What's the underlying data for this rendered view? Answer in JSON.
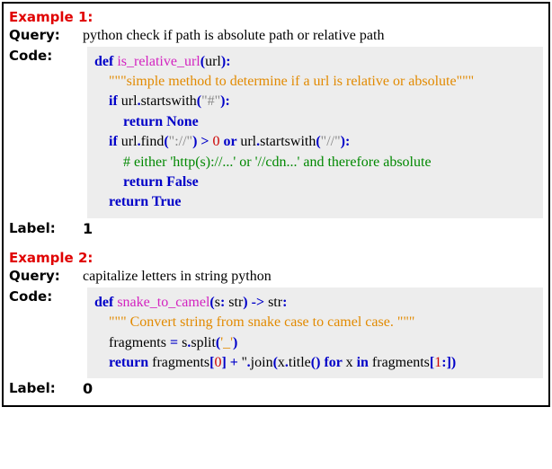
{
  "ex1": {
    "title": "Example 1:",
    "queryLabel": "Query:",
    "query": "python check if path is absolute path or relative path",
    "codeLabel": "Code:",
    "code": {
      "l1a": "def ",
      "l1b": "is_relative_url",
      "l1c": "(",
      "l1d": "url",
      "l1e": "):",
      "l2": "\"\"\"simple method to determine if a url is relative or absolute\"\"\"",
      "l3a": "if ",
      "l3b": "url",
      "l3c": ".",
      "l3d": "startswith",
      "l3e": "(",
      "l3f": "\"#\"",
      "l3g": "):",
      "l4": "return None",
      "l5a": "if ",
      "l5b": "url",
      "l5c": ".",
      "l5d": "find",
      "l5e": "(",
      "l5f": "\"://\"",
      "l5g": ") > ",
      "l5h": "0",
      "l5i": " or ",
      "l5j": "url",
      "l5k": ".",
      "l5l": "startswith",
      "l5m": "(",
      "l5n": "\"//\"",
      "l5o": "):",
      "l6": "# either 'http(s)://...' or '//cdn...' and therefore absolute",
      "l7": "return False",
      "l8": "return True"
    },
    "labelLabel": "Label:",
    "label": "1"
  },
  "ex2": {
    "title": "Example 2:",
    "queryLabel": "Query:",
    "query": "capitalize letters in string python",
    "codeLabel": "Code:",
    "code": {
      "l1a": "def ",
      "l1b": "snake_to_camel",
      "l1c": "(",
      "l1d": "s",
      "l1e": ": ",
      "l1f": "str",
      "l1g": ") -> ",
      "l1h": "str",
      "l1i": ":",
      "l2": "\"\"\" Convert string from snake case to camel case. \"\"\"",
      "l3a": "fragments ",
      "l3b": "= ",
      "l3c": "s",
      "l3d": ".",
      "l3e": "split",
      "l3f": "(",
      "l3g": "'_'",
      "l3h": ")",
      "l4a": "return ",
      "l4b": "fragments",
      "l4c": "[",
      "l4d": "0",
      "l4e": "] + ",
      "l4f": "''",
      "l4g": ".",
      "l4h": "join",
      "l4i": "(",
      "l4j": "x",
      "l4k": ".",
      "l4l": "title",
      "l4m": "() for ",
      "l4n": "x ",
      "l4o": "in ",
      "l4p": "fragments",
      "l4q": "[",
      "l4r": "1",
      "l4s": ":])"
    },
    "labelLabel": "Label:",
    "label": "0"
  }
}
